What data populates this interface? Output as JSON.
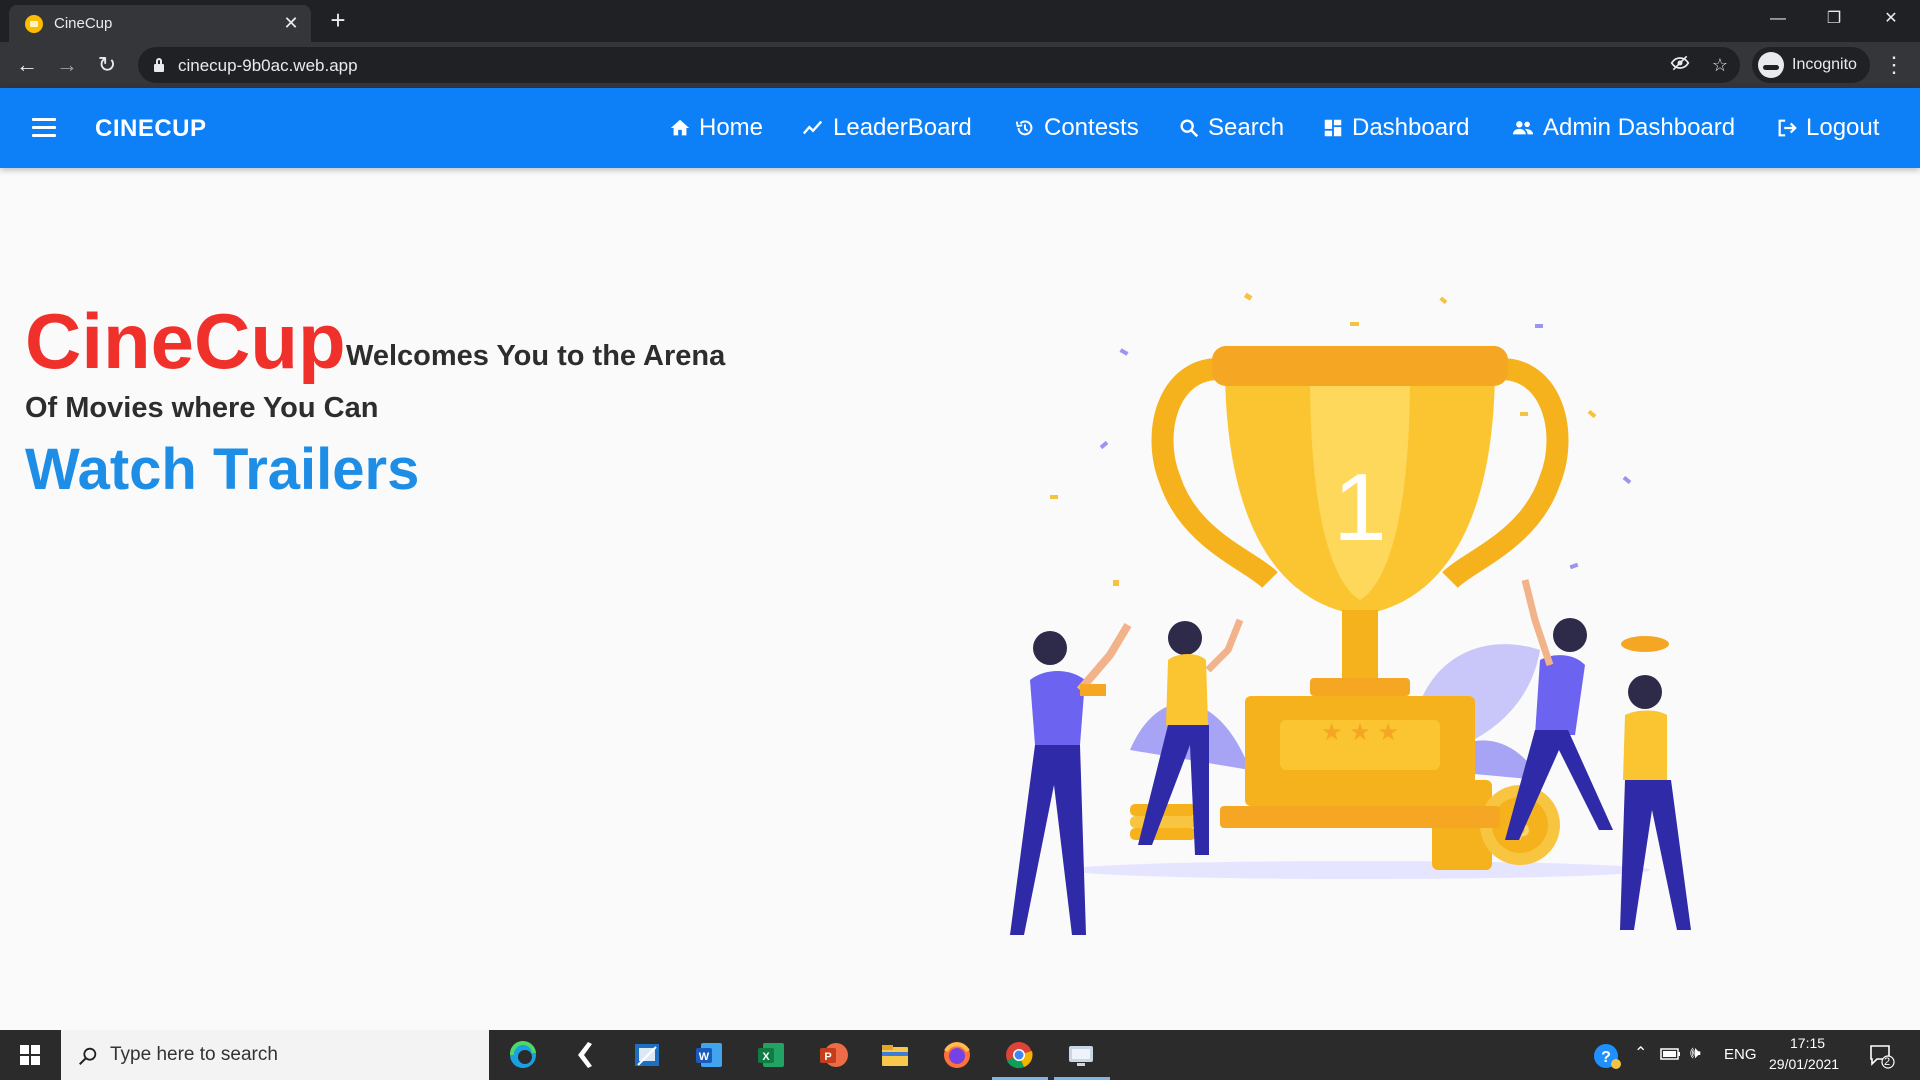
{
  "browser": {
    "tab_title": "CineCup",
    "url": "cinecup-9b0ac.web.app",
    "profile_label": "Incognito",
    "icons": [
      "app-favicon",
      "close-icon",
      "plus-icon",
      "minimize-icon",
      "restore-icon",
      "close-window-icon",
      "back-arrow-icon",
      "forward-arrow-icon",
      "reload-icon",
      "lock-icon",
      "eye-off-icon",
      "star-icon",
      "incognito-icon",
      "more-vert-icon"
    ]
  },
  "appbar": {
    "brand": "CINECUP",
    "color": "#0d7ff7",
    "nav": [
      {
        "label": "Home",
        "icon": "home-icon"
      },
      {
        "label": "LeaderBoard",
        "icon": "trending-up-icon"
      },
      {
        "label": "Contests",
        "icon": "history-icon"
      },
      {
        "label": "Search",
        "icon": "search-icon"
      },
      {
        "label": "Dashboard",
        "icon": "dashboard-icon"
      },
      {
        "label": "Admin Dashboard",
        "icon": "people-icon"
      },
      {
        "label": "Logout",
        "icon": "logout-icon"
      }
    ]
  },
  "hero": {
    "brand": "CineCup",
    "line1": "Welcomes You to the Arena",
    "line2": "Of Movies where You Can",
    "highlight": "Watch Trailers",
    "brand_color": "#f0302b",
    "highlight_color": "#1e8de6",
    "trophy_number": "1"
  },
  "taskbar": {
    "search_placeholder": "Type here to search",
    "apps": [
      "edge-icon",
      "vscode-icon",
      "snipping-tool-icon",
      "word-icon",
      "excel-icon",
      "powerpoint-icon",
      "file-explorer-icon",
      "firefox-icon",
      "chrome-icon",
      "display-app-icon"
    ],
    "language": "ENG",
    "time": "17:15",
    "date": "29/01/2021",
    "notification_count": "2"
  }
}
